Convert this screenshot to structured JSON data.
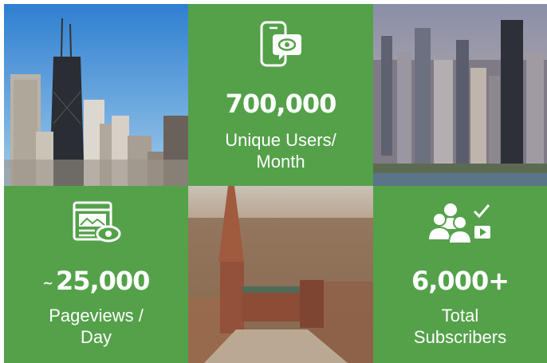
{
  "colors": {
    "accent_green": "#54a14a"
  },
  "tiles": {
    "users": {
      "icon": "mobile-video-icon",
      "value": "700,000",
      "label_line1": "Unique Users/",
      "label_line2": "Month"
    },
    "pageviews": {
      "icon": "web-page-view-icon",
      "prefix": "~",
      "value": "25,000",
      "label_line1": "Pageviews /",
      "label_line2": "Day"
    },
    "subscribers": {
      "icon": "group-subscribe-icon",
      "value": "6,000+",
      "label_line1": "Total",
      "label_line2": "Subscribers"
    }
  },
  "photos": [
    "chicago-skyscraper-photo",
    "chicago-aerial-skyline-photo",
    "cathedral-aerial-photo"
  ]
}
